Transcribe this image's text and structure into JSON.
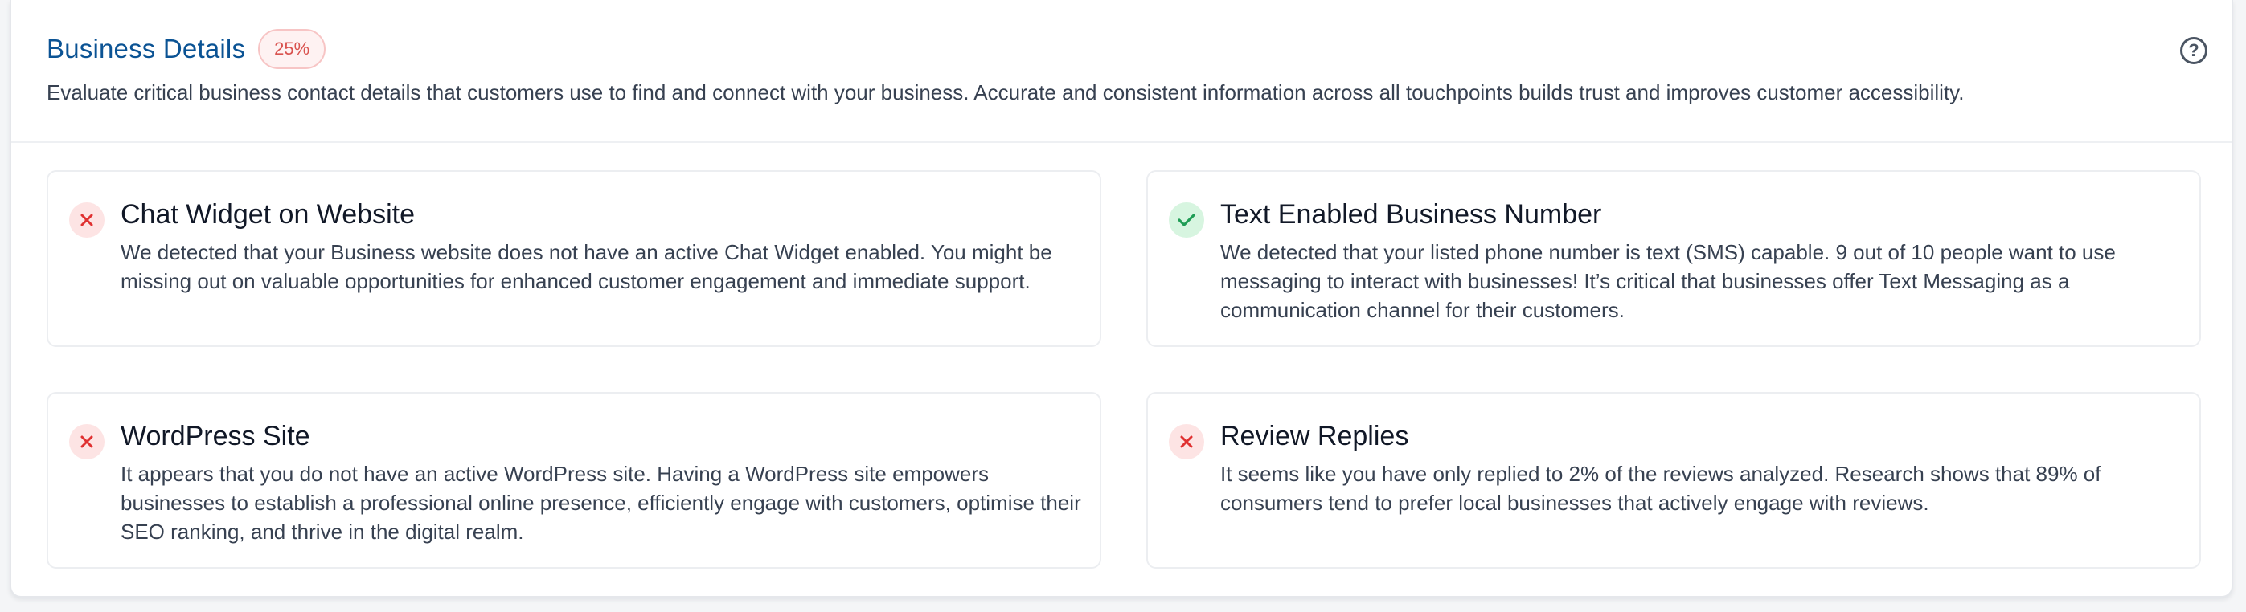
{
  "section": {
    "title": "Business Details",
    "score_badge": "25%",
    "help_icon": "question-circle-icon",
    "description": "Evaluate critical business contact details that customers use to find and connect with your business. Accurate and consistent information across all touchpoints builds trust and improves customer accessibility."
  },
  "colors": {
    "title": "#0b5394",
    "badge_text": "#d9534f",
    "fail_icon": "#e03131",
    "pass_icon": "#1f9d55"
  },
  "items": [
    {
      "title": "Chat Widget on Website",
      "status": "fail",
      "icon": "x-icon",
      "text": "We detected that your Business website does not have an active Chat Widget enabled. You might be missing out on valuable opportunities for enhanced customer engagement and immediate support."
    },
    {
      "title": "Text Enabled Business Number",
      "status": "pass",
      "icon": "check-icon",
      "text": "We detected that your listed phone number is text (SMS) capable. 9 out of 10 people want to use messaging to interact with businesses! It’s critical that businesses offer Text Messaging as a communication channel for their customers."
    },
    {
      "title": "WordPress Site",
      "status": "fail",
      "icon": "x-icon",
      "text": "It appears that you do not have an active WordPress site. Having a WordPress site empowers businesses to establish a professional online presence, efficiently engage with customers, optimise their SEO ranking, and thrive in the digital realm."
    },
    {
      "title": "Review Replies",
      "status": "fail",
      "icon": "x-icon",
      "text": "It seems like you have only replied to 2% of the reviews analyzed. Research shows that 89% of consumers tend to prefer local businesses that actively engage with reviews."
    }
  ]
}
